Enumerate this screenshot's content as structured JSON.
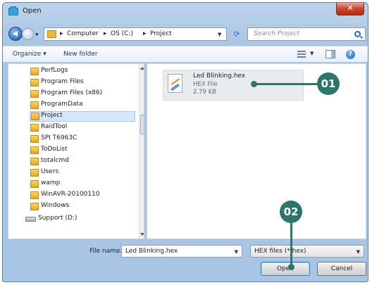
{
  "window": {
    "title": "Open"
  },
  "address": {
    "crumbs": [
      "Computer",
      "OS (C:)",
      "Project"
    ],
    "search_placeholder": "Search Project"
  },
  "toolbar": {
    "organize_label": "Organize ▾",
    "new_folder_label": "New folder",
    "help_label": "?"
  },
  "sidebar": {
    "items": [
      {
        "label": "PerfLogs"
      },
      {
        "label": "Program Files"
      },
      {
        "label": "Program Files (x86)"
      },
      {
        "label": "ProgramData"
      },
      {
        "label": "Project",
        "selected": true
      },
      {
        "label": "RaidTool"
      },
      {
        "label": "SPI T6963C"
      },
      {
        "label": "ToDoList"
      },
      {
        "label": "totalcmd"
      },
      {
        "label": "Users"
      },
      {
        "label": "wamp"
      },
      {
        "label": "WinAVR-20100110"
      },
      {
        "label": "Windows"
      }
    ],
    "drive_label": "Support (D:)"
  },
  "file": {
    "name": "Led Blinking.hex",
    "type": "HEX File",
    "size": "2.79 KB",
    "icon": "hex-file-icon"
  },
  "footer": {
    "filename_label": "File name:",
    "filename_value": "Led Blinking.hex",
    "filter_value": "HEX files (*.hex)",
    "open_label": "Open",
    "cancel_label": "Cancel"
  },
  "callouts": {
    "first": "01",
    "second": "02"
  },
  "colors": {
    "callout": "#2e746b",
    "selection": "#d7e7f9"
  }
}
